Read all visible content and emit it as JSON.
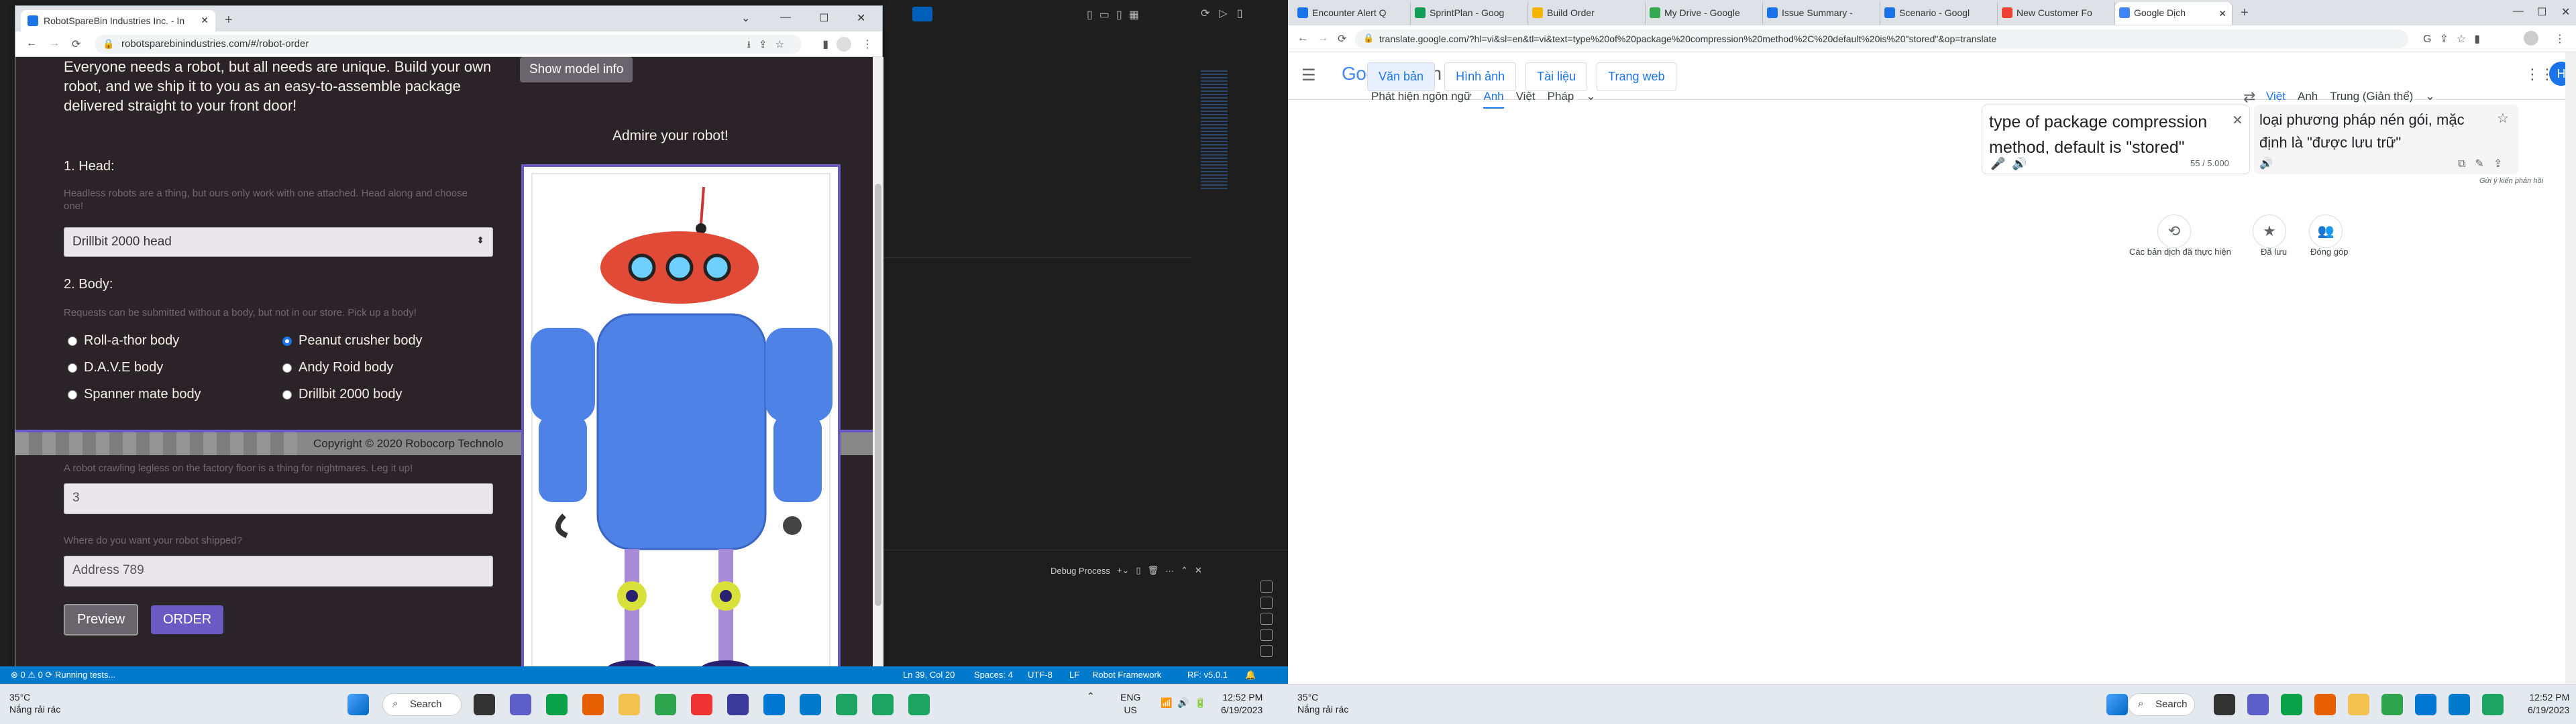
{
  "left": {
    "browser": {
      "tab_title": "RobotSpareBin Industries Inc. - In",
      "url": "robotsparebinindustries.com/#/robot-order"
    },
    "page": {
      "intro": "Everyone needs a robot, but all needs are unique. Build your own robot, and we ship it to you as an easy-to-assemble package delivered straight to your front door!",
      "show_model_info": "Show model info",
      "admire": "Admire your robot!",
      "head_label": "1. Head:",
      "head_hint": "Headless robots are a thing, but ours only work with one attached. Head along and choose one!",
      "head_selected": "Drillbit 2000 head",
      "body_label": "2. Body:",
      "body_hint": "Requests can be submitted without a body, but not in our store. Pick up a body!",
      "bodies": [
        "Roll-a-thor body",
        "Peanut crusher body",
        "D.A.V.E body",
        "Andy Roid body",
        "Spanner mate body",
        "Drillbit 2000 body"
      ],
      "copyright": "Copyright © 2020 Robocorp Technolo",
      "legs_hint": "A robot crawling legless on the factory floor is a thing for nightmares. Leg it up!",
      "legs_value": "3",
      "address_hint": "Where do you want your robot shipped?",
      "address_value": "Address 789",
      "preview": "Preview",
      "order": "ORDER"
    },
    "vscode": {
      "debug_process": "Debug Process",
      "status_left": "⊗ 0 ⚠ 0   ⟳  Running tests...",
      "status_ln": "Ln 39, Col 20",
      "status_spaces": "Spaces: 4",
      "status_enc": "UTF-8",
      "status_eol": "LF",
      "status_lang": "Robot Framework",
      "status_rf": "RF: v5.0.1"
    },
    "taskbar": {
      "temp": "35°C",
      "weather": "Nắng rải rác",
      "search": "Search",
      "lang1": "ENG",
      "lang2": "US",
      "time": "12:52 PM",
      "date": "6/19/2023"
    }
  },
  "right": {
    "tabs": [
      "Encounter Alert Q",
      "SprintPlan - Goog",
      "Build Order",
      "My Drive - Google",
      "Issue Summary -",
      "Scenario - Googl",
      "New Customer Fo",
      "Google Dịch"
    ],
    "url": "translate.google.com/?hl=vi&sl=en&tl=vi&text=type%20of%20package%20compression%20method%2C%20default%20is%20\"stored\"&op=translate",
    "logo_g": "Google",
    "logo_d": "Dịch",
    "avatar": "H",
    "modes": [
      "Văn bản",
      "Hình ảnh",
      "Tài liệu",
      "Trang web"
    ],
    "src_langs": [
      "Phát hiện ngôn ngữ",
      "Anh",
      "Việt",
      "Pháp"
    ],
    "tgt_langs": [
      "Việt",
      "Anh",
      "Trung (Giản thể)"
    ],
    "source_text": "type of package compression method, default is \"stored\"",
    "count": "55 / 5.000",
    "target_text": "loại phương pháp nén gói, mặc định là \"được lưu trữ\"",
    "feedback": "Gửi ý kiến phản hồi",
    "history": "Các bản dịch đã thực hiện",
    "saved": "Đã lưu",
    "contribute": "Đóng góp",
    "taskbar": {
      "temp": "35°C",
      "weather": "Nắng rải rác",
      "search": "Search",
      "time": "12:52 PM",
      "date": "6/19/2023"
    }
  },
  "colors": {
    "vscode_blue": "#007acc",
    "accent_purple": "#6c5ac4",
    "google_blue": "#1a73e8"
  }
}
